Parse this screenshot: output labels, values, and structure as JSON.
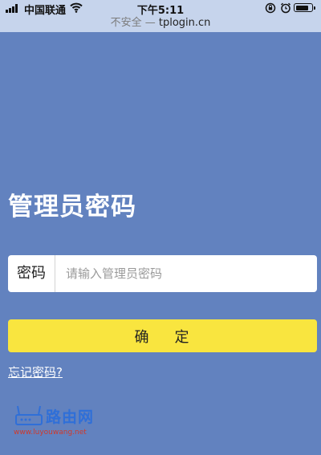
{
  "status_bar": {
    "carrier": "中国联通",
    "time": "下午5:11",
    "battery_level_pct": 85,
    "icons": [
      "signal-icon",
      "wifi-icon",
      "rotation-lock-icon",
      "alarm-icon",
      "battery-icon"
    ]
  },
  "url_bar": {
    "insecure_label": "不安全",
    "separator": "—",
    "domain": "tplogin.cn"
  },
  "page": {
    "title": "管理员密码",
    "password_label": "密码",
    "password_placeholder": "请输入管理员密码",
    "password_value": "",
    "confirm_char_1": "确",
    "confirm_char_2": "定",
    "forgot_link": "忘记密码?"
  },
  "watermark": {
    "brand": "路由网",
    "site": "www.luyouwang.net"
  },
  "colors": {
    "background": "#6282bf",
    "browser_bar": "#c6d4ec",
    "confirm_button": "#f9e53f",
    "watermark_brand": "#2f6fd8",
    "watermark_site": "#d0392b"
  }
}
